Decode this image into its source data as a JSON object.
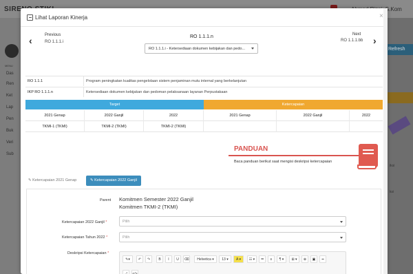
{
  "background": {
    "brand": "SIRENO STIKI",
    "user": "Ahmad Rizqi, S.Kom",
    "menu_header": "MENU",
    "menu_items": [
      "Das",
      "Ren",
      "Ket",
      "Lap",
      "Pen",
      "Buk",
      "Veri",
      "Sub"
    ],
    "refresh_label": "Refresh",
    "side_text": [
      "iksi",
      "ksi"
    ]
  },
  "modal": {
    "title": "Lihat Laporan Kinerja",
    "close_glyph": "×",
    "nav": {
      "prev_label": "Previous",
      "prev_code": "RO 1.1.1.i",
      "next_label": "Next",
      "next_code": "RO 1.1.1.bb",
      "current_title": "RO 1.1.1.n",
      "selected_option": "RO 1.1.1.i - Ketersediaan dokumen kebijakan dan pedo..."
    },
    "info": [
      {
        "label": "RO 1.1.1",
        "value": "Program peningkatan kualitas pengelolaan sistem penjaminan mutu internal yang berkelanjutan"
      },
      {
        "label": "IKP RO 1.1.1.n",
        "value": "Ketersediaan dokumen kebijakan dan pedoman pelaksanaan layanan Perpustakaan"
      }
    ],
    "target_header": "Target",
    "ketercapaian_header": "Ketercapaian",
    "target_cols": [
      "2021 Genap",
      "2022 Ganjil",
      "2022"
    ],
    "ketercapaian_cols": [
      "2021 Genap",
      "2022 Ganjil",
      "2022"
    ],
    "target_vals": [
      "TKMI-1 (TKMI)",
      "TKMI-2 (TKMI)",
      "TKMI-2 (TKMI)"
    ],
    "ketercapaian_vals": [
      "",
      "",
      ""
    ],
    "panduan": {
      "title": "PANDUAN",
      "subtitle": "Baca panduan berikut saat mengisi deskripsi ketercapaian"
    },
    "tabs": [
      {
        "label": "Ketercapaian 2021 Genap",
        "active": false
      },
      {
        "label": "Ketercapaian 2022 Ganjil",
        "active": true
      }
    ],
    "form": {
      "parent_label": "Parent",
      "parent_line1": "Komitmen Semester 2022 Ganjil",
      "parent_line2": "Komitmen TKMI-2 (TKMI)",
      "field1_label": "Ketercapaian 2022 Ganjil",
      "field1_placeholder": "Pilih",
      "field2_label": "Ketercapaian Tahun 2022",
      "field2_placeholder": "Pilih",
      "field3_label": "Deskripsi Ketercapaian",
      "required_mark": "*"
    },
    "toolbar": [
      "✎▾",
      "↶",
      "↷",
      "B",
      "I",
      "U",
      "⌫",
      "Helvetica ▾",
      "13 ▾",
      "A ▾",
      "☷ ▾",
      "≔",
      "≡",
      "¶ ▾",
      "⊞ ▾",
      "⊕",
      "▣",
      "━",
      "⤢",
      "</>"
    ]
  },
  "colors": {
    "target_blue": "#3fa9dd",
    "ketercapaian_orange": "#f0a830",
    "accent_red": "#d9534f",
    "tab_blue": "#3c8dbc"
  }
}
